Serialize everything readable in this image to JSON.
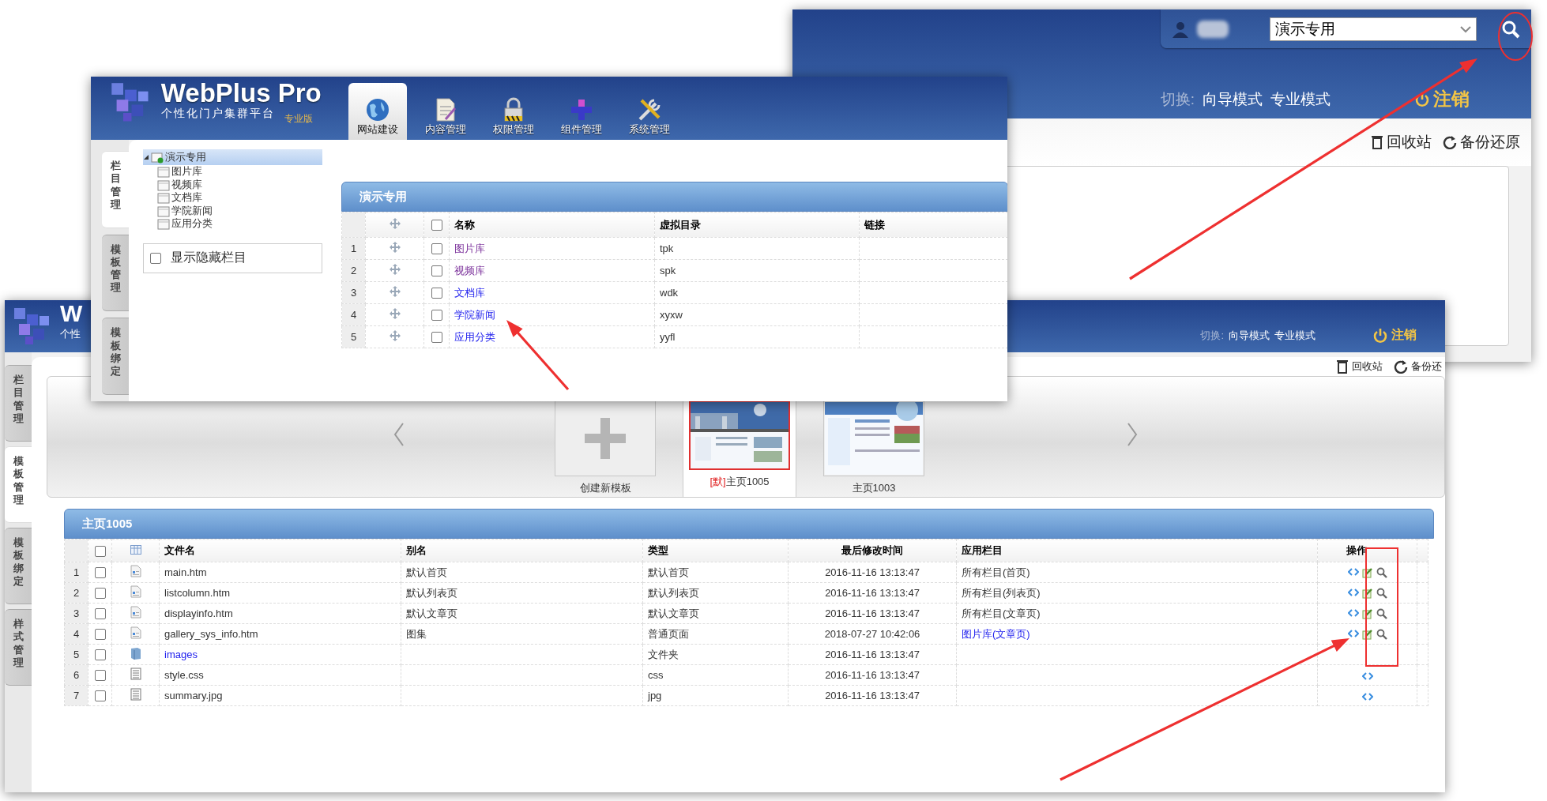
{
  "back_window": {
    "site_select": {
      "value": "演示专用"
    },
    "switch_label": "切换:",
    "modes": [
      "向导模式",
      "专业模式"
    ],
    "logout": "注销",
    "tools": [
      {
        "kind": "trash",
        "label": "回收站"
      },
      {
        "kind": "restore",
        "label": "备份还原"
      }
    ]
  },
  "template_window": {
    "brand": {
      "title": "W",
      "subtitle": "个性"
    },
    "switch_label": "切换:",
    "modes": [
      "向导模式",
      "专业模式"
    ],
    "logout": "注销",
    "tools": [
      {
        "kind": "trash",
        "label": "回收站"
      },
      {
        "kind": "restore",
        "label": "备份还"
      }
    ],
    "side_tabs": [
      {
        "label": "栏目管理",
        "selected": false
      },
      {
        "label": "模板管理",
        "selected": true
      },
      {
        "label": "模板绑定",
        "selected": false
      },
      {
        "label": "样式管理",
        "selected": false
      }
    ],
    "templates": [
      {
        "kind": "create",
        "label": "创建新模板",
        "selected": false
      },
      {
        "kind": "thumbnail",
        "default_mark": "[默]",
        "label": "主页1005",
        "selected": true
      },
      {
        "kind": "thumbnail",
        "label": "主页1003",
        "selected": false
      }
    ],
    "file_panel": {
      "title": "主页1005",
      "header_checked": false,
      "columns": [
        "文件名",
        "别名",
        "类型",
        "最后修改时间",
        "应用栏目",
        "操作"
      ],
      "rows": [
        {
          "index": "1",
          "checked": false,
          "kind": "page",
          "name": "main.htm",
          "name_link": false,
          "alias": "默认首页",
          "type": "默认首页",
          "modified": "2016-11-16 13:13:47",
          "applied": "所有栏目(首页)",
          "applied_link": false,
          "actions": [
            {
              "kind": "code"
            },
            {
              "kind": "edit"
            },
            {
              "kind": "preview"
            }
          ]
        },
        {
          "index": "2",
          "checked": false,
          "kind": "page",
          "name": "listcolumn.htm",
          "name_link": false,
          "alias": "默认列表页",
          "type": "默认列表页",
          "modified": "2016-11-16 13:13:47",
          "applied": "所有栏目(列表页)",
          "applied_link": false,
          "actions": [
            {
              "kind": "code"
            },
            {
              "kind": "edit"
            },
            {
              "kind": "preview"
            }
          ]
        },
        {
          "index": "3",
          "checked": false,
          "kind": "page",
          "name": "displayinfo.htm",
          "name_link": false,
          "alias": "默认文章页",
          "type": "默认文章页",
          "modified": "2016-11-16 13:13:47",
          "applied": "所有栏目(文章页)",
          "applied_link": false,
          "actions": [
            {
              "kind": "code"
            },
            {
              "kind": "edit"
            },
            {
              "kind": "preview"
            }
          ]
        },
        {
          "index": "4",
          "checked": false,
          "kind": "page",
          "name": "gallery_sys_info.htm",
          "name_link": false,
          "alias": "图集",
          "type": "普通页面",
          "modified": "2018-07-27 10:42:06",
          "applied": "图片库(文章页)",
          "applied_link": true,
          "actions": [
            {
              "kind": "code"
            },
            {
              "kind": "edit"
            },
            {
              "kind": "preview"
            }
          ]
        },
        {
          "index": "5",
          "checked": false,
          "kind": "folder",
          "name": "images",
          "name_link": true,
          "type": "文件夹",
          "modified": "2016-11-16 13:13:47"
        },
        {
          "index": "6",
          "checked": false,
          "kind": "text",
          "name": "style.css",
          "name_link": false,
          "type": "css",
          "modified": "2016-11-16 13:13:47",
          "actions": [
            {
              "kind": "code"
            }
          ]
        },
        {
          "index": "7",
          "checked": false,
          "kind": "text",
          "name": "summary.jpg",
          "name_link": false,
          "type": "jpg",
          "modified": "2016-11-16 13:13:47",
          "actions": [
            {
              "kind": "code"
            }
          ]
        }
      ]
    }
  },
  "main_window": {
    "brand": {
      "title": "WebPlus Pro",
      "subtitle": "个性化门户集群平台",
      "edition": "专业版"
    },
    "nav": [
      {
        "kind": "globe",
        "label": "网站建设",
        "selected": true
      },
      {
        "kind": "document",
        "label": "内容管理",
        "selected": false
      },
      {
        "kind": "lock",
        "label": "权限管理",
        "selected": false
      },
      {
        "kind": "component",
        "label": "组件管理",
        "selected": false
      },
      {
        "kind": "tools",
        "label": "系统管理",
        "selected": false
      }
    ],
    "side_tabs": [
      {
        "label": "栏目管理",
        "selected": true
      },
      {
        "label": "模板管理",
        "selected": false
      },
      {
        "label": "模板绑定",
        "selected": false
      }
    ],
    "tree": {
      "label": "演示专用",
      "expanded": true,
      "selected": true,
      "children": [
        {
          "label": "图片库"
        },
        {
          "label": "视频库"
        },
        {
          "label": "文档库"
        },
        {
          "label": "学院新闻"
        },
        {
          "label": "应用分类"
        }
      ]
    },
    "show_hidden": {
      "label": "显示隐藏栏目",
      "checked": false
    },
    "column_panel": {
      "title": "演示专用",
      "header_checked": false,
      "columns": [
        "名称",
        "虚拟目录",
        "链接"
      ],
      "rows": [
        {
          "index": "1",
          "checked": false,
          "name": "图片库",
          "visited": true,
          "directory": "tpk"
        },
        {
          "index": "2",
          "checked": false,
          "name": "视频库",
          "visited": true,
          "directory": "spk"
        },
        {
          "index": "3",
          "checked": false,
          "name": "文档库",
          "visited": false,
          "directory": "wdk"
        },
        {
          "index": "4",
          "checked": false,
          "name": "学院新闻",
          "visited": false,
          "directory": "xyxw"
        },
        {
          "index": "5",
          "checked": false,
          "name": "应用分类",
          "visited": false,
          "directory": "yyfl"
        }
      ]
    }
  }
}
